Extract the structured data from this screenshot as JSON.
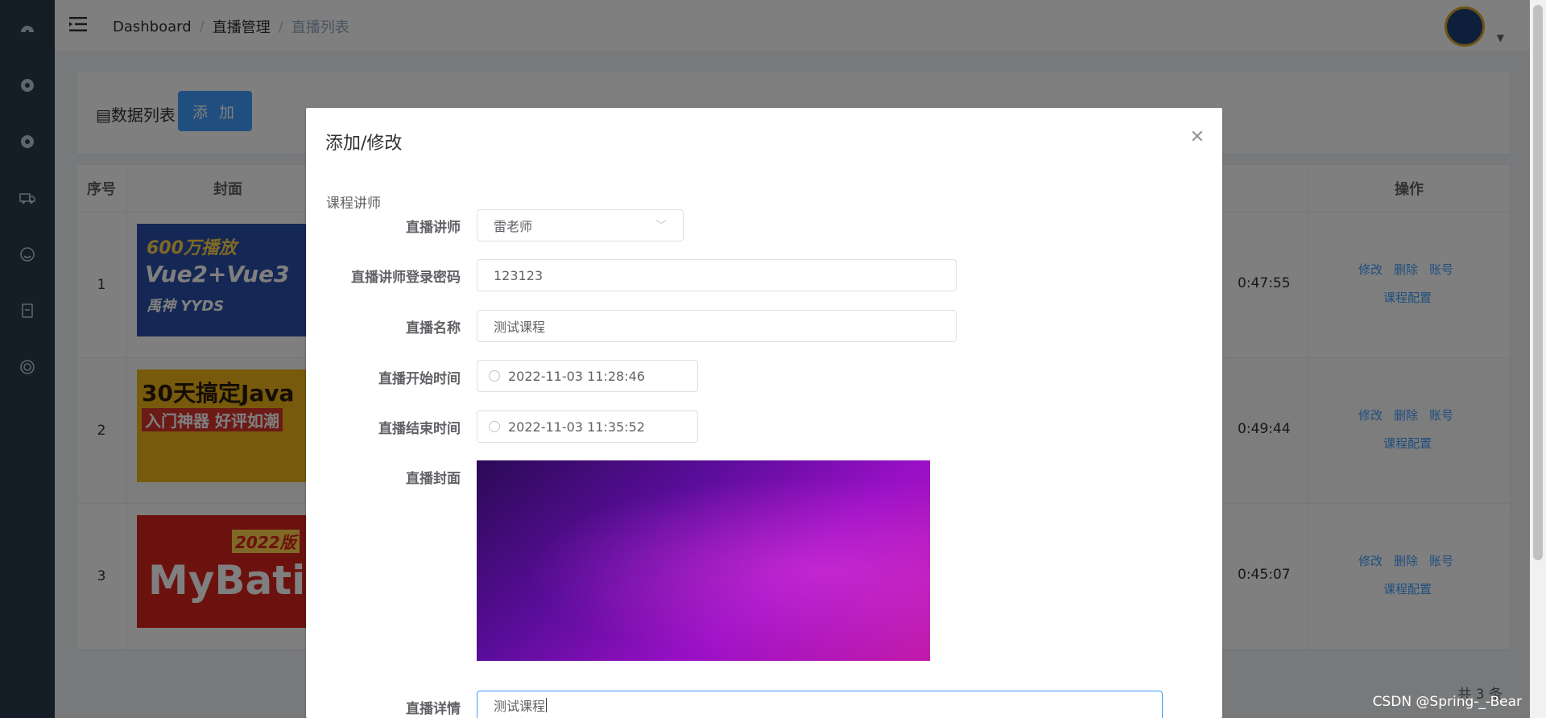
{
  "breadcrumb": [
    "Dashboard",
    "直播管理",
    "直播列表"
  ],
  "page": {
    "card_title": "数据列表",
    "add_button": "添 加",
    "table_headers": {
      "no": "序号",
      "cover": "封面",
      "operations": "操作"
    },
    "rows": [
      {
        "no": "1",
        "time_fragment": "0:47:55",
        "cover_title_1": "600万播放",
        "cover_title_2": "Vue2+Vue3",
        "cover_title_3": "禹神 YYDS"
      },
      {
        "no": "2",
        "time_fragment": "0:49:44",
        "cover_title_1": "30天搞定Java",
        "cover_title_2": "入门神器  好评如潮"
      },
      {
        "no": "3",
        "time_fragment": "0:45:07",
        "cover_title_1": "2022版",
        "cover_title_2": "MyBatis"
      }
    ],
    "row_actions": [
      "修改",
      "删除",
      "账号"
    ],
    "row_action_config": "课程配置",
    "total": "共 3 条"
  },
  "dialog": {
    "title": "添加/修改",
    "section_label": "课程讲师",
    "teacher_label": "直播讲师",
    "teacher_value": "雷老师",
    "password_label": "直播讲师登录密码",
    "password_value": "123123",
    "name_label": "直播名称",
    "name_value": "测试课程",
    "start_label": "直播开始时间",
    "start_value": "2022-11-03 11:28:46",
    "end_label": "直播结束时间",
    "end_value": "2022-11-03 11:35:52",
    "cover_label": "直播封面",
    "detail_label": "直播详情",
    "detail_value": "测试课程"
  },
  "watermark": "CSDN @Spring-_-Bear",
  "colors": {
    "sidebar": "#2b3a4e",
    "primary": "#409eff",
    "overlay": "rgba(0,0,0,0.5)"
  }
}
